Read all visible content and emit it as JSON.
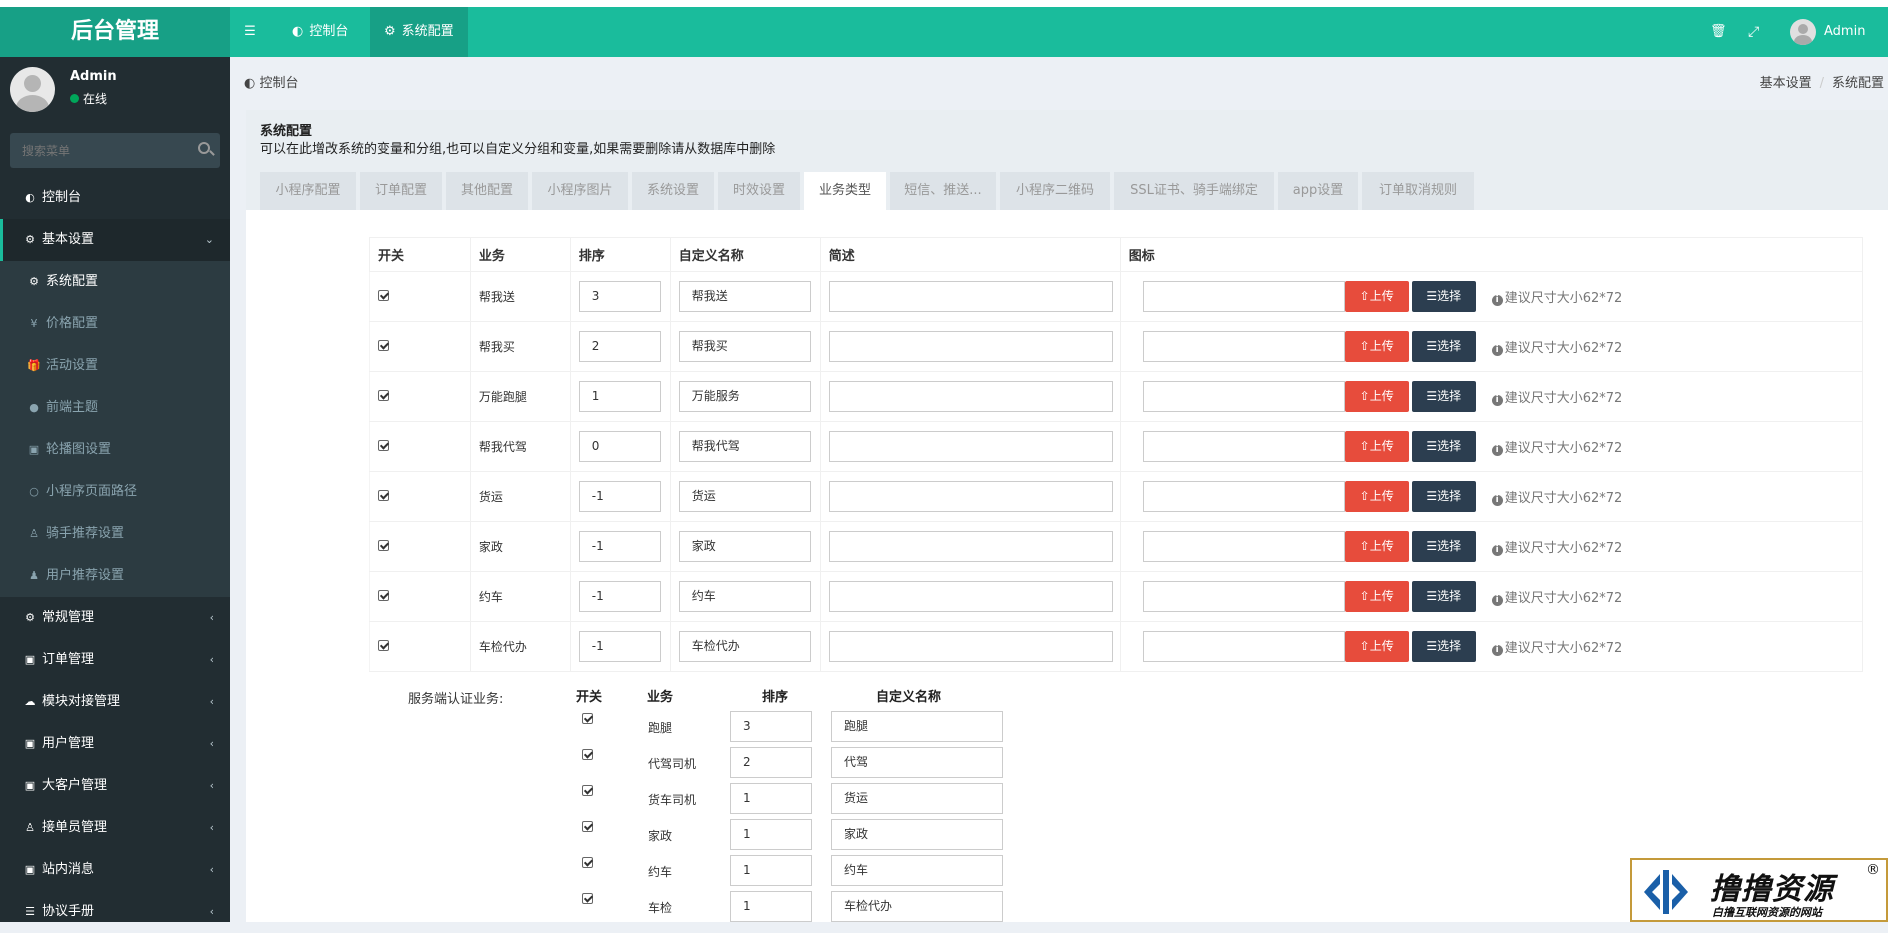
{
  "app": {
    "title": "后台管理"
  },
  "topnav": {
    "tabs": [
      {
        "label": "控制台",
        "icon": "dashboard-icon"
      },
      {
        "label": "系统配置",
        "icon": "gear-icon"
      }
    ],
    "user": "Admin"
  },
  "sidebar": {
    "user_name": "Admin",
    "status": "在线",
    "search_placeholder": "搜索菜单",
    "items": [
      {
        "label": "控制台",
        "icon": "dashboard-icon"
      },
      {
        "label": "基本设置",
        "icon": "gear-icon"
      },
      {
        "label": "系统配置",
        "icon": "gear-icon"
      },
      {
        "label": "价格配置",
        "icon": "yen-icon"
      },
      {
        "label": "活动设置",
        "icon": "gift-icon"
      },
      {
        "label": "前端主题",
        "icon": "circle-icon"
      },
      {
        "label": "轮播图设置",
        "icon": "image-icon"
      },
      {
        "label": "小程序页面路径",
        "icon": "circle-outline-icon"
      },
      {
        "label": "骑手推荐设置",
        "icon": "user-icon"
      },
      {
        "label": "用户推荐设置",
        "icon": "users-icon"
      },
      {
        "label": "常规管理",
        "icon": "cogs-icon"
      },
      {
        "label": "订单管理",
        "icon": "book-icon"
      },
      {
        "label": "模块对接管理",
        "icon": "cloud-icon"
      },
      {
        "label": "用户管理",
        "icon": "user-box-icon"
      },
      {
        "label": "大客户管理",
        "icon": "building-icon"
      },
      {
        "label": "接单员管理",
        "icon": "user-icon"
      },
      {
        "label": "站内消息",
        "icon": "message-icon"
      },
      {
        "label": "协议手册",
        "icon": "list-icon"
      }
    ]
  },
  "breadcrumb": {
    "left": "控制台",
    "right": [
      "基本设置",
      "系统配置"
    ]
  },
  "panel": {
    "title": "系统配置",
    "description": "可以在此增改系统的变量和分组,也可以自定义分组和变量,如果需要删除请从数据库中删除",
    "tabs": [
      "小程序配置",
      "订单配置",
      "其他配置",
      "小程序图片",
      "系统设置",
      "时效设置",
      "业务类型",
      "短信、推送...",
      "小程序二维码",
      "SSL证书、骑手端绑定",
      "app设置",
      "订单取消规则"
    ],
    "active_tab": "业务类型"
  },
  "business_table": {
    "headers": [
      "开关",
      "业务",
      "排序",
      "自定义名称",
      "简述",
      "图标"
    ],
    "upload_label": "上传",
    "select_label": "选择",
    "hint": "建议尺寸大小62*72",
    "rows": [
      {
        "enabled": true,
        "name": "帮我送",
        "sort": "3",
        "custom": "帮我送"
      },
      {
        "enabled": true,
        "name": "帮我买",
        "sort": "2",
        "custom": "帮我买"
      },
      {
        "enabled": true,
        "name": "万能跑腿",
        "sort": "1",
        "custom": "万能服务"
      },
      {
        "enabled": true,
        "name": "帮我代驾",
        "sort": "0",
        "custom": "帮我代驾"
      },
      {
        "enabled": true,
        "name": "货运",
        "sort": "-1",
        "custom": "货运"
      },
      {
        "enabled": true,
        "name": "家政",
        "sort": "-1",
        "custom": "家政"
      },
      {
        "enabled": true,
        "name": "约车",
        "sort": "-1",
        "custom": "约车"
      },
      {
        "enabled": true,
        "name": "车检代办",
        "sort": "-1",
        "custom": "车检代办"
      }
    ]
  },
  "service_table": {
    "label": "服务端认证业务:",
    "headers": [
      "开关",
      "业务",
      "排序",
      "自定义名称"
    ],
    "rows": [
      {
        "enabled": true,
        "name": "跑腿",
        "sort": "3",
        "custom": "跑腿"
      },
      {
        "enabled": true,
        "name": "代驾司机",
        "sort": "2",
        "custom": "代驾"
      },
      {
        "enabled": true,
        "name": "货车司机",
        "sort": "1",
        "custom": "货运"
      },
      {
        "enabled": true,
        "name": "家政",
        "sort": "1",
        "custom": "家政"
      },
      {
        "enabled": true,
        "name": "约车",
        "sort": "1",
        "custom": "约车"
      },
      {
        "enabled": true,
        "name": "车检",
        "sort": "1",
        "custom": "车检代办"
      }
    ]
  },
  "watermark": {
    "title": "撸撸资源",
    "subtitle": "白撸互联网资源的网站",
    "mark": "®"
  }
}
